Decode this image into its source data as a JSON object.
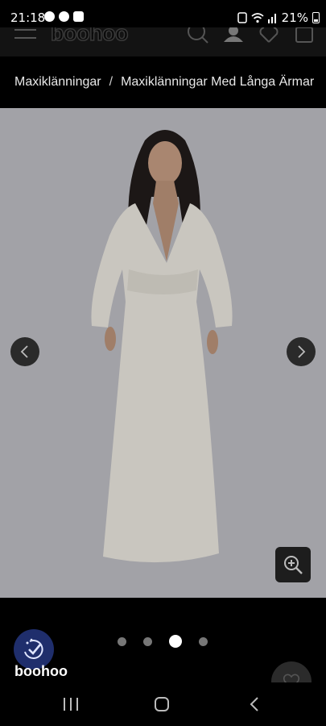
{
  "status_bar": {
    "time": "21:18",
    "battery": "21%"
  },
  "header": {
    "logo": "boohoo",
    "icons": [
      "search-icon",
      "account-icon",
      "wishlist-icon",
      "bag-icon"
    ]
  },
  "breadcrumb": {
    "items": [
      "Maxiklänningar",
      "Maxiklänningar Med Långa Ärmar"
    ],
    "separator": "/"
  },
  "gallery": {
    "current_index": 3,
    "total": 4,
    "prev_icon": "chevron-left-icon",
    "next_icon": "chevron-right-icon",
    "zoom_icon": "zoom-in-icon"
  },
  "badge": {
    "label": "boohoo"
  },
  "colors": {
    "background": "#000000",
    "photo_bg": "#9e9ea3",
    "dot_active": "#ffffff",
    "dot_inactive": "#777777",
    "badge": "#1f2e6c"
  }
}
